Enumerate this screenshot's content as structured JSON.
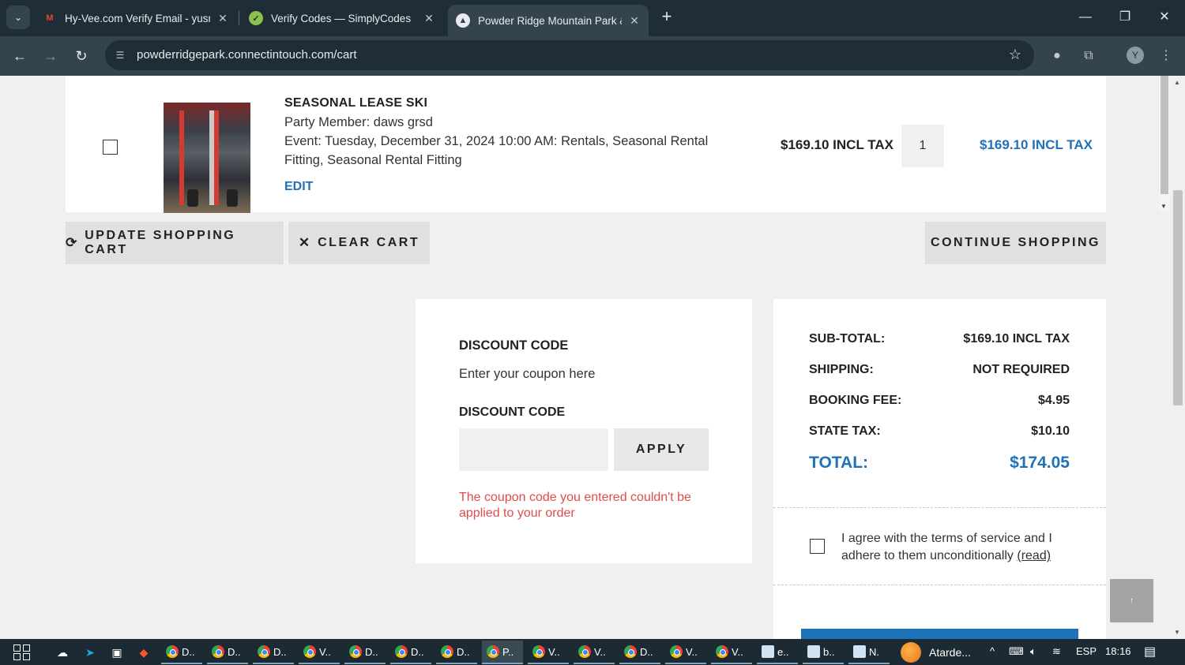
{
  "browser": {
    "tabs": [
      {
        "title": "Hy-Vee.com Verify Email - yusm",
        "active": false
      },
      {
        "title": "Verify Codes — SimplyCodes",
        "active": false
      },
      {
        "title": "Powder Ridge Mountain Park &",
        "active": true
      }
    ],
    "url": "powderridgepark.connectintouch.com/cart",
    "profile_initial": "Y"
  },
  "cart": {
    "item": {
      "title": "SEASONAL LEASE SKI",
      "party_member": "Party Member: daws grsd",
      "event_line1": "Event: Tuesday, December 31, 2024 10:00 AM: Rentals, Seasonal Rental",
      "event_line2": "Fitting, Seasonal Rental Fitting",
      "edit_label": "EDIT",
      "price": "$169.10 INCL TAX",
      "quantity": "1",
      "line_total": "$169.10 INCL TAX"
    },
    "buttons": {
      "update": "UPDATE SHOPPING CART",
      "clear": "CLEAR CART",
      "continue": "CONTINUE SHOPPING"
    }
  },
  "discount": {
    "title": "DISCOUNT CODE",
    "subtitle": "Enter your coupon here",
    "field_label": "DISCOUNT CODE",
    "input_value": "",
    "apply_label": "APPLY",
    "error": "The coupon code you entered couldn't be applied to your order"
  },
  "summary": {
    "rows": [
      {
        "label": "SUB-TOTAL:",
        "value": "$169.10 INCL TAX"
      },
      {
        "label": "SHIPPING:",
        "value": "NOT REQUIRED"
      },
      {
        "label": "BOOKING FEE:",
        "value": "$4.95"
      },
      {
        "label": "STATE TAX:",
        "value": "$10.10"
      }
    ],
    "total_label": "TOTAL:",
    "total_value": "$174.05",
    "terms_text": "I agree with the terms of service and I adhere to them unconditionally",
    "terms_link": "(read)"
  },
  "taskbar": {
    "apps": [
      "D..",
      "D..",
      "D..",
      "V..",
      "D..",
      "D..",
      "D..",
      "P..",
      "V..",
      "V..",
      "D..",
      "V..",
      "V..",
      "e..",
      "b..",
      "N."
    ],
    "weather": "Atarde...",
    "language": "ESP",
    "time": "18:16"
  },
  "colors": {
    "accent": "#1f72b8",
    "error": "#e04b4b",
    "chrome_dark": "#1f2d36",
    "chrome_toolbar": "#34444e"
  }
}
